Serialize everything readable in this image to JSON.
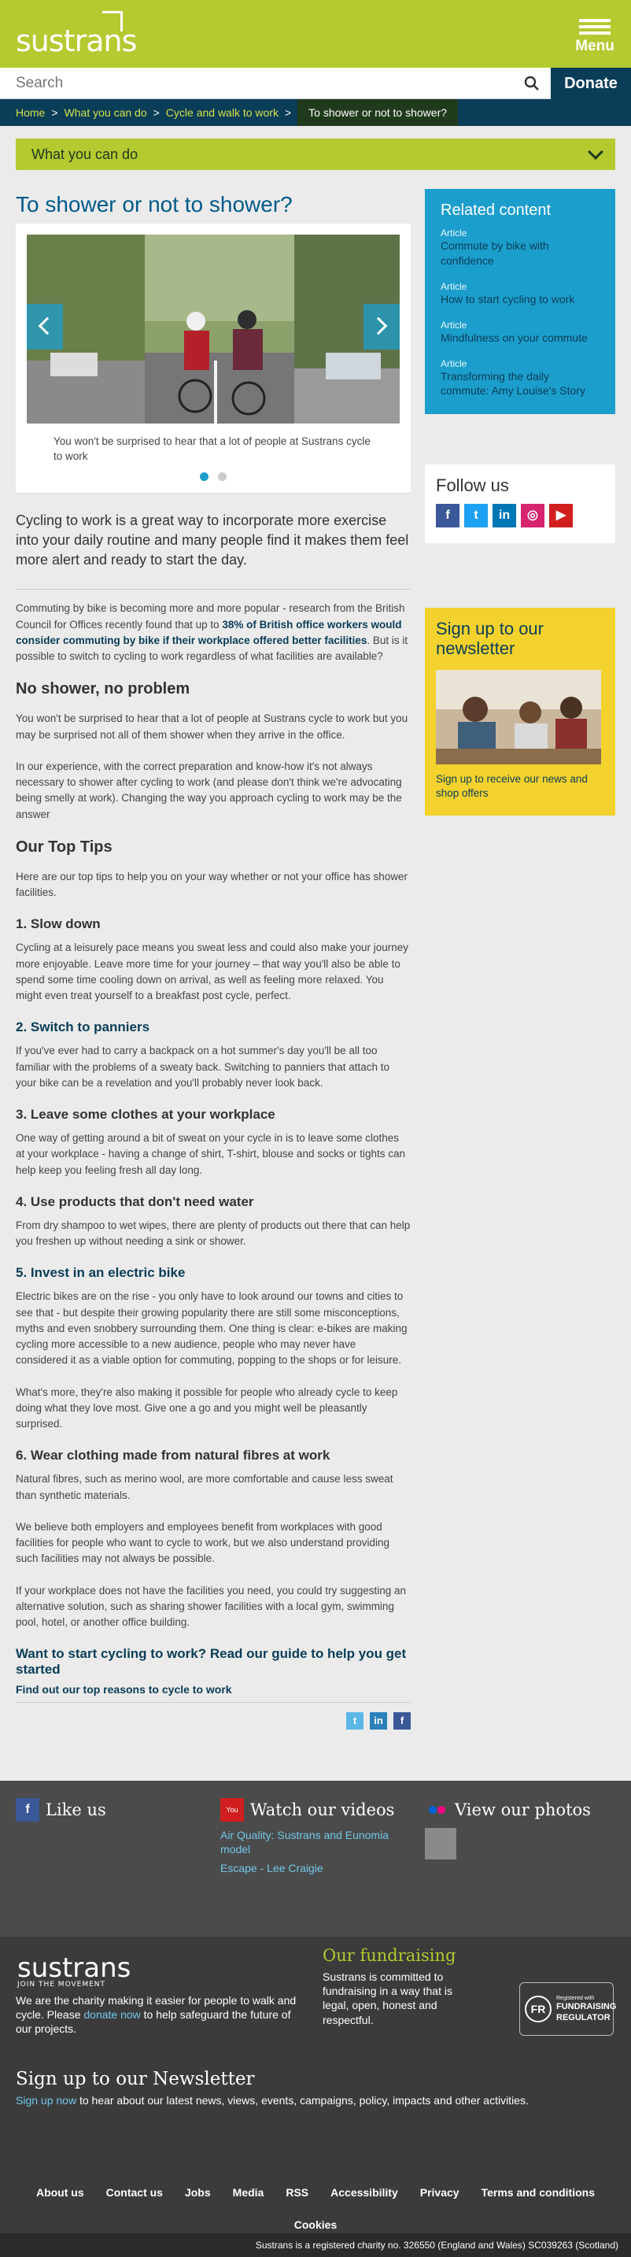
{
  "header": {
    "logo": "sustrans",
    "menu_label": "Menu"
  },
  "search": {
    "placeholder": "Search",
    "donate": "Donate"
  },
  "breadcrumb": [
    "Home",
    "What you can do",
    "Cycle and walk to work",
    "To shower or not to shower?"
  ],
  "section_dropdown": "What you can do",
  "article": {
    "title": "To shower or not to shower?",
    "slide_caption": "You won't be surprised to hear that a lot of people at Sustrans cycle to work",
    "intro": "Cycling to work is a great way to incorporate more exercise into your daily routine and many people find it makes them feel more alert and ready to start the day.",
    "p1_a": "Commuting by bike is becoming more and more popular - research from the British Council for Offices recently found that up to ",
    "p1_b": "38% of British office workers would consider commuting by bike if their workplace offered better facilities",
    "p1_c": ". But is it possible to switch to cycling to work regardless of what facilities are available?",
    "h_no_shower": "No shower, no problem",
    "p2": "You won't be surprised to hear that a lot of people at Sustrans cycle to work but you may be surprised not all of them shower when they arrive in the office.",
    "p3": "In our experience, with the correct preparation and know-how it's not always necessary to shower after cycling to work (and please don't think we're advocating being smelly at work).  Changing the way you approach cycling to work may be the answer",
    "h_tips": "Our Top Tips",
    "p4": "Here are our top tips to help you on your way whether or not your office has shower facilities.",
    "tips": [
      {
        "h": "1. Slow down",
        "p": "Cycling at a leisurely pace means you sweat less and could also make your journey more enjoyable. Leave more time for your journey – that way you'll also be able to spend some time cooling down on arrival, as well as feeling more relaxed. You might even treat yourself to a breakfast post cycle, perfect."
      },
      {
        "h": "2. Switch to panniers",
        "p": "If you've ever had to carry a backpack on a hot summer's day you'll be all too familiar with the problems of a sweaty back. Switching to panniers that attach to your bike can be a revelation and you'll probably never look back."
      },
      {
        "h": "3. Leave some clothes at your workplace",
        "p": "One way of getting around a bit of sweat on your cycle in is to leave some clothes at your workplace - having a change of shirt, T-shirt, blouse and socks or tights can help keep you feeling fresh all day long."
      },
      {
        "h": "4. Use products that don't need water",
        "p": "From dry shampoo to wet wipes, there are plenty of products out there that can help you freshen up without needing a sink or shower."
      },
      {
        "h": "5. Invest in an electric bike",
        "p": "Electric bikes are on the rise - you only have to look around our towns and cities to see that - but despite their growing popularity there are still some misconceptions, myths and even snobbery surrounding them. One thing is clear: e-bikes are making cycling more accessible to a new audience, people who may never have considered it as a viable option for commuting, popping to the shops or for leisure."
      },
      {
        "h": "",
        "p": "What's more, they're also making it possible for people who already cycle to keep doing what they love most. Give one a go and you might well be pleasantly surprised."
      },
      {
        "h": "6. Wear clothing made from natural fibres at work",
        "p": "Natural fibres, such as merino wool, are more comfortable and cause less sweat than synthetic materials."
      }
    ],
    "p5": "We believe both employers and employees benefit from workplaces with good facilities for people who want to cycle to work, but we also understand providing such facilities may not always be possible.",
    "p6": "If your workplace does not have the facilities you need, you could try suggesting an alternative solution, such as sharing shower facilities with a local gym, swimming pool, hotel, or another office building.",
    "cta_heading": "Want to start cycling to work? Read our guide to help you get started",
    "cta_link": "Find out our top reasons to cycle to work"
  },
  "related": {
    "heading": "Related content",
    "items": [
      {
        "kind": "Article",
        "title": "Commute by bike with confidence"
      },
      {
        "kind": "Article",
        "title": "How to start cycling to work"
      },
      {
        "kind": "Article",
        "title": "Mindfulness on your commute"
      },
      {
        "kind": "Article",
        "title": "Transforming the daily commute: Amy Louise's Story"
      }
    ]
  },
  "follow": {
    "heading": "Follow us"
  },
  "newsletter_box": {
    "heading": "Sign up to our newsletter",
    "text": "Sign up to receive our news and shop offers"
  },
  "footer": {
    "like_us": "Like us",
    "watch_videos": "Watch our videos",
    "video_links": [
      "Air Quality: Sustrans and Eunomia model",
      "Escape - Lee Craigie"
    ],
    "view_photos": "View our photos",
    "logo_tag": "JOIN THE MOVEMENT",
    "desc_a": "We are the charity making it easier for people to walk and cycle. Please ",
    "desc_link": "donate now",
    "desc_b": " to help safeguard the future of our projects.",
    "fundraising_heading": "Our fundraising",
    "fundraising_text": "Sustrans is committed to fundraising in a way that is legal, open, honest and respectful.",
    "regulator_small": "Registered with",
    "regulator_name": "FUNDRAISING REGULATOR",
    "regulator_mark": "FR",
    "newsletter_heading": "Sign up to our Newsletter",
    "newsletter_link": "Sign up now",
    "newsletter_text": " to hear about our latest news, views, events, campaigns, policy, impacts and other activities.",
    "links": [
      "About us",
      "Contact us",
      "Jobs",
      "Media",
      "RSS",
      "Accessibility",
      "Privacy",
      "Terms and conditions",
      "Cookies"
    ],
    "charity": "Sustrans is a registered charity no. 326550 (England and Wales) SC039263 (Scotland)"
  },
  "colors": {
    "brand_green": "#b5c930",
    "dark_blue": "#0a3d57",
    "light_blue": "#1c9ecc",
    "yellow": "#f3d22e"
  }
}
